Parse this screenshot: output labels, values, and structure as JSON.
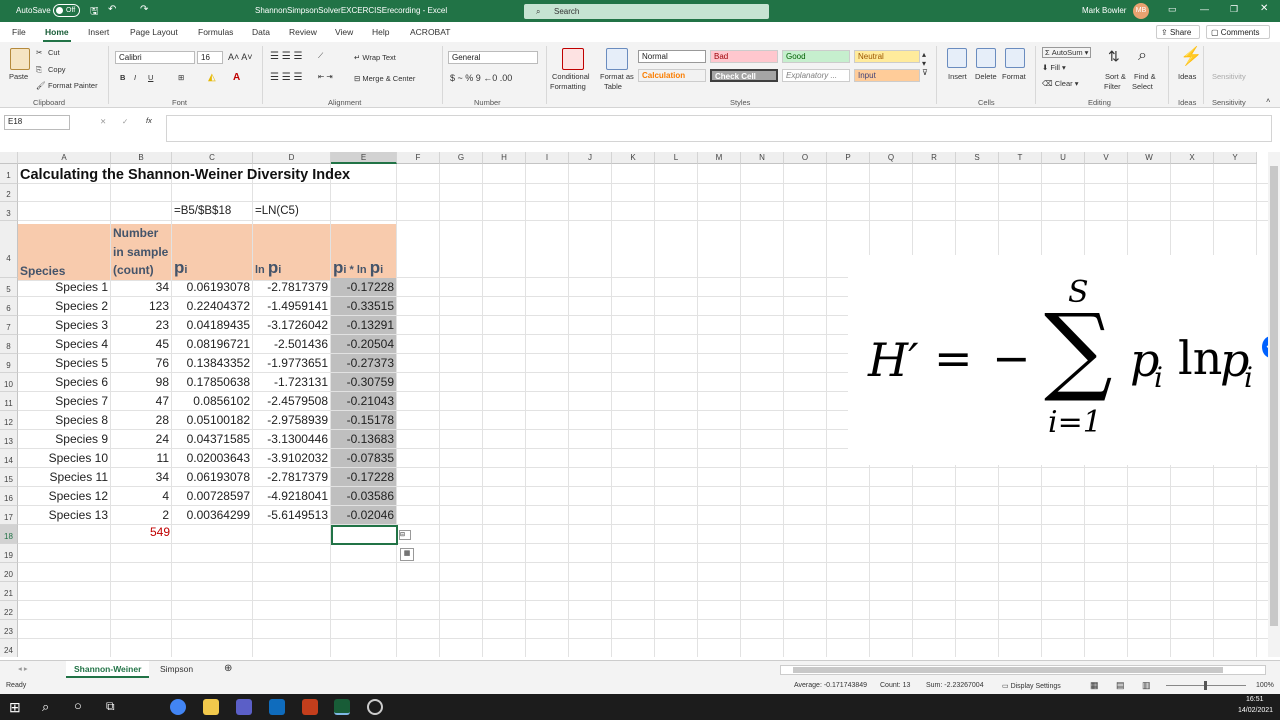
{
  "titlebar": {
    "autosave": "AutoSave",
    "toggle": "Off",
    "doc": "ShannonSimpsonSolverEXCERCISErecording - Excel",
    "search": "Search",
    "user": "Mark Bowler",
    "initials": "MB"
  },
  "menu": {
    "tabs": [
      "File",
      "Home",
      "Insert",
      "Page Layout",
      "Formulas",
      "Data",
      "Review",
      "View",
      "Help",
      "ACROBAT"
    ],
    "share": "Share",
    "comments": "Comments"
  },
  "ribbon": {
    "paste": "Paste",
    "cut": "Cut",
    "copy": "Copy",
    "format_painter": "Format Painter",
    "clipboard": "Clipboard",
    "font_name": "Calibri",
    "font_size": "16",
    "font": "Font",
    "wrap": "Wrap Text",
    "merge": "Merge & Center",
    "alignment": "Alignment",
    "number_format": "General",
    "number": "Number",
    "cond": "Conditional",
    "cond2": "Formatting",
    "fmt_table": "Format as",
    "fmt_table2": "Table",
    "styles": [
      "Normal",
      "Bad",
      "Good",
      "Neutral",
      "Calculation",
      "Check Cell",
      "Explanatory ...",
      "Input"
    ],
    "styles_label": "Styles",
    "insert": "Insert",
    "delete": "Delete",
    "format": "Format",
    "cells": "Cells",
    "autosum": "AutoSum",
    "fill": "Fill",
    "clear": "Clear",
    "sort": "Sort &",
    "sort2": "Filter",
    "find": "Find &",
    "find2": "Select",
    "editing": "Editing",
    "ideas": "Ideas",
    "sensitivity": "Sensitivity"
  },
  "formula_bar": {
    "namebox": "E18",
    "fx": "fx",
    "value": ""
  },
  "columns": [
    "A",
    "B",
    "C",
    "D",
    "E",
    "F",
    "G",
    "H",
    "I",
    "J",
    "K",
    "L",
    "M",
    "N",
    "O",
    "P",
    "Q",
    "R",
    "S",
    "T",
    "U",
    "V",
    "W",
    "X",
    "Y"
  ],
  "rows": [
    "1",
    "2",
    "3",
    "4",
    "5",
    "6",
    "7",
    "8",
    "9",
    "10",
    "11",
    "12",
    "13",
    "14",
    "15",
    "16",
    "17",
    "18",
    "19",
    "20",
    "21",
    "22",
    "23",
    "24"
  ],
  "sheet": {
    "title": "Calculating the Shannon-Weiner Diversity Index",
    "formula_c": "=B5/$B$18",
    "formula_d": "=LN(C5)",
    "h_species": "Species",
    "h_number": "Number",
    "h_number2": "in sample",
    "h_number3": "(count)",
    "h_p": "p",
    "h_i": "i",
    "h_ln": "ln ",
    "h_pp": "p",
    "h_pi_ln": "p",
    "h_pi_i": "i",
    "h_star": " * ln ",
    "data": [
      {
        "s": "Species 1",
        "n": "34",
        "p": "0.06193078",
        "ln": "-2.7817379",
        "x": "-0.17228"
      },
      {
        "s": "Species 2",
        "n": "123",
        "p": "0.22404372",
        "ln": "-1.4959141",
        "x": "-0.33515"
      },
      {
        "s": "Species 3",
        "n": "23",
        "p": "0.04189435",
        "ln": "-3.1726042",
        "x": "-0.13291"
      },
      {
        "s": "Species 4",
        "n": "45",
        "p": "0.08196721",
        "ln": "-2.501436",
        "x": "-0.20504"
      },
      {
        "s": "Species 5",
        "n": "76",
        "p": "0.13843352",
        "ln": "-1.9773651",
        "x": "-0.27373"
      },
      {
        "s": "Species 6",
        "n": "98",
        "p": "0.17850638",
        "ln": "-1.723131",
        "x": "-0.30759"
      },
      {
        "s": "Species 7",
        "n": "47",
        "p": "0.0856102",
        "ln": "-2.4579508",
        "x": "-0.21043"
      },
      {
        "s": "Species 8",
        "n": "28",
        "p": "0.05100182",
        "ln": "-2.9758939",
        "x": "-0.15178"
      },
      {
        "s": "Species 9",
        "n": "24",
        "p": "0.04371585",
        "ln": "-3.1300446",
        "x": "-0.13683"
      },
      {
        "s": "Species 10",
        "n": "11",
        "p": "0.02003643",
        "ln": "-3.9102032",
        "x": "-0.07835"
      },
      {
        "s": "Species 11",
        "n": "34",
        "p": "0.06193078",
        "ln": "-2.7817379",
        "x": "-0.17228"
      },
      {
        "s": "Species 12",
        "n": "4",
        "p": "0.00728597",
        "ln": "-4.9218041",
        "x": "-0.03586"
      },
      {
        "s": "Species 13",
        "n": "2",
        "p": "0.00364299",
        "ln": "-5.6149513",
        "x": "-0.02046"
      }
    ],
    "total": "549"
  },
  "equation": {
    "H": "H′",
    "eq": "=",
    "minus": "−",
    "S": "S",
    "i1": "i=1",
    "p": "p",
    "sub": "i",
    "ln": "ln"
  },
  "sheet_tabs": [
    "Shannon-Weiner",
    "Simpson"
  ],
  "status": {
    "ready": "Ready",
    "average": "Average: -0.171743849",
    "count": "Count: 13",
    "sum": "Sum: -2.23267004",
    "display": "Display Settings",
    "zoom": "100%"
  },
  "taskbar": {
    "time": "16:51",
    "date": "14/02/2021"
  }
}
